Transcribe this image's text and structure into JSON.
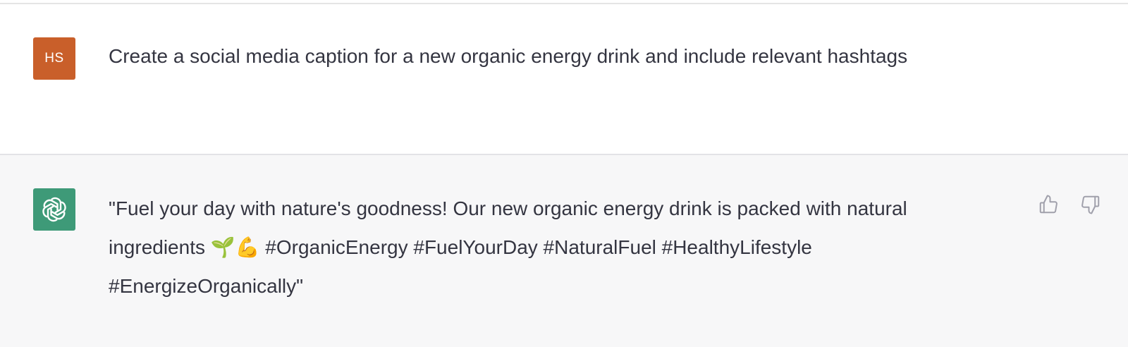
{
  "user_message": {
    "avatar_initials": "HS",
    "avatar_color": "#c95f2a",
    "text": "Create a social media caption for a new organic energy drink and include relevant hashtags"
  },
  "assistant_message": {
    "avatar_icon": "openai-logo-icon",
    "avatar_color": "#3e9a78",
    "text": "\"Fuel your day with nature's goodness! Our new organic energy drink is packed with natural ingredients 🌱💪 #OrganicEnergy #FuelYourDay #NaturalFuel #HealthyLifestyle #EnergizeOrganically\""
  },
  "feedback": {
    "thumbs_up_icon": "thumbs-up-icon",
    "thumbs_down_icon": "thumbs-down-icon"
  }
}
